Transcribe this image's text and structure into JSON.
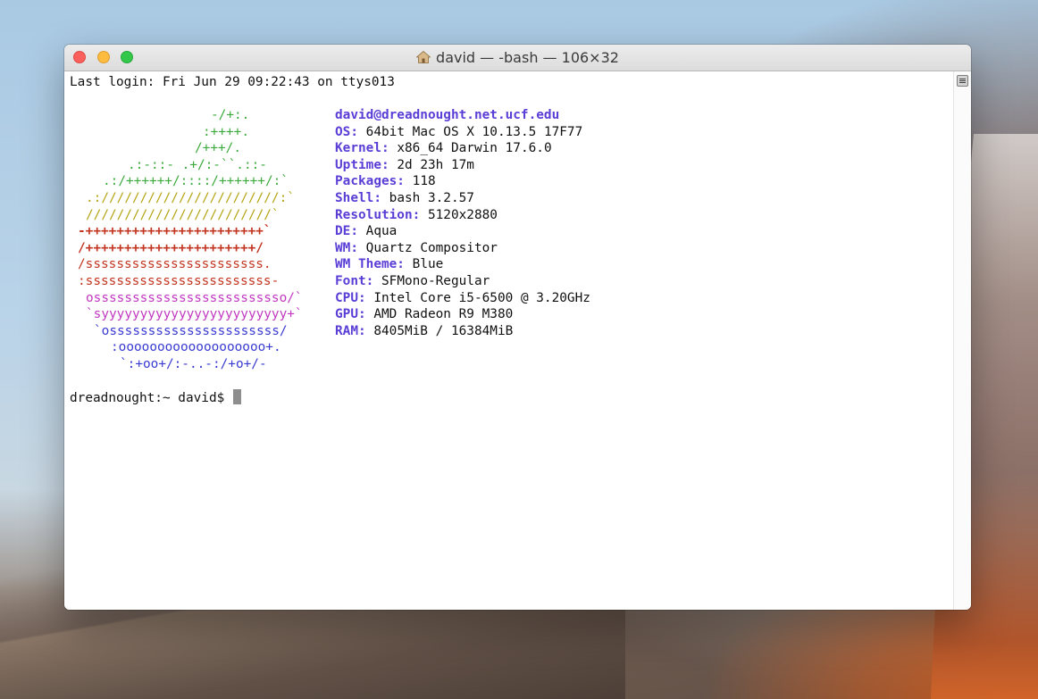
{
  "window": {
    "title": "david — -bash — 106×32"
  },
  "terminal": {
    "last_login": "Last login: Fri Jun 29 09:22:43 on ttys013",
    "logo": [
      {
        "text": "-/+:.",
        "color": "#3daa3d",
        "bold": false
      },
      {
        "text": ":++++.",
        "color": "#3daa3d",
        "bold": false
      },
      {
        "text": "/+++/.",
        "color": "#3daa3d",
        "bold": false
      },
      {
        "text": ".:-::- .+/:-``.::-",
        "color": "#3daa3d",
        "bold": false
      },
      {
        "text": ".:/++++++/::::/++++++/:`",
        "color": "#3daa3d",
        "bold": false
      },
      {
        "text": ".:///////////////////////:`",
        "color": "#b5a514",
        "bold": false
      },
      {
        "text": "////////////////////////`",
        "color": "#b5a514",
        "bold": false
      },
      {
        "text": "-+++++++++++++++++++++++`",
        "color": "#c23521",
        "bold": true
      },
      {
        "text": "/++++++++++++++++++++++/",
        "color": "#c23521",
        "bold": true
      },
      {
        "text": "/sssssssssssssssssssssss.",
        "color": "#c23521",
        "bold": false
      },
      {
        "text": ":ssssssssssssssssssssssss-",
        "color": "#c23521",
        "bold": false
      },
      {
        "text": "osssssssssssssssssssssssso/`",
        "color": "#c039c0",
        "bold": false
      },
      {
        "text": "`syyyyyyyyyyyyyyyyyyyyyyyy+`",
        "color": "#c039c0",
        "bold": false
      },
      {
        "text": "`ossssssssssssssssssssss/",
        "color": "#3a3bd1",
        "bold": false
      },
      {
        "text": ":ooooooooooooooooooo+.",
        "color": "#3a3bd1",
        "bold": false
      },
      {
        "text": "`:+oo+/:-..-:/+o+/-",
        "color": "#3a3bd1",
        "bold": false
      }
    ],
    "host": "david@dreadnought.net.ucf.edu",
    "info": [
      {
        "key": "OS:",
        "value": "64bit Mac OS X 10.13.5 17F77"
      },
      {
        "key": "Kernel:",
        "value": "x86_64 Darwin 17.6.0"
      },
      {
        "key": "Uptime:",
        "value": "2d 23h 17m"
      },
      {
        "key": "Packages:",
        "value": "118"
      },
      {
        "key": "Shell:",
        "value": "bash 3.2.57"
      },
      {
        "key": "Resolution:",
        "value": "5120x2880"
      },
      {
        "key": "DE:",
        "value": "Aqua"
      },
      {
        "key": "WM:",
        "value": "Quartz Compositor"
      },
      {
        "key": "WM Theme:",
        "value": "Blue"
      },
      {
        "key": "Font:",
        "value": "SFMono-Regular"
      },
      {
        "key": "CPU:",
        "value": "Intel Core i5-6500 @ 3.20GHz"
      },
      {
        "key": "GPU:",
        "value": "AMD Radeon R9 M380"
      },
      {
        "key": "RAM:",
        "value": "8405MiB / 16384MiB"
      }
    ],
    "prompt": "dreadnought:~ david$"
  }
}
